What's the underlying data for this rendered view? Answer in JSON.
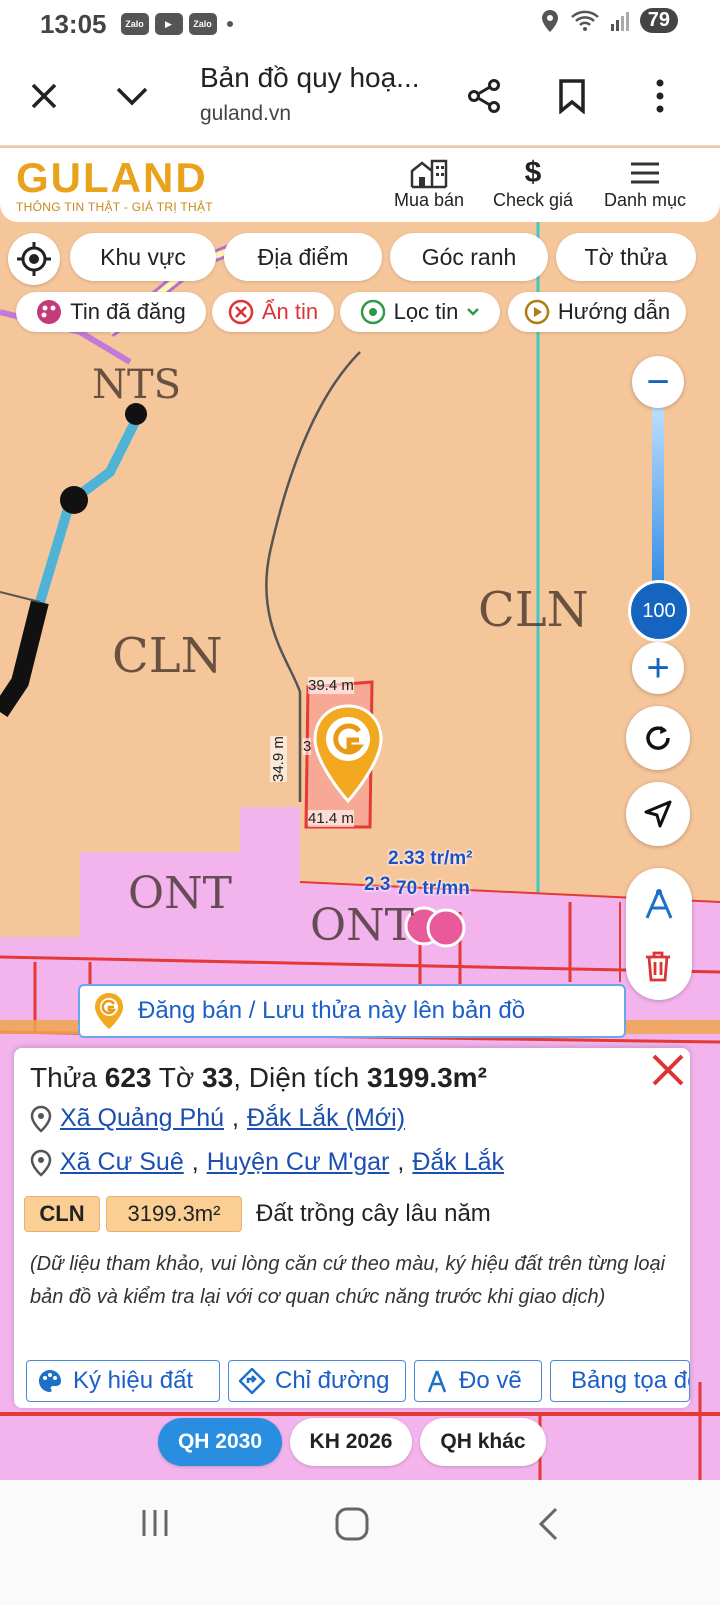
{
  "status": {
    "time": "13:05",
    "apps": [
      "Zalo",
      "Zalo",
      "Zalo"
    ],
    "battery": "79"
  },
  "browser": {
    "title": "Bản đồ quy hoạ...",
    "url": "guland.vn"
  },
  "site": {
    "logo": "GULAND",
    "tagline": "THÔNG TIN THẬT - GIÁ TRỊ THẬT",
    "nav": [
      "Mua bán",
      "Check giá",
      "Danh mục"
    ],
    "nav_icons": [
      "building-icon",
      "dollar-icon",
      "menu-icon"
    ]
  },
  "filters": {
    "row1": [
      "Khu vực",
      "Địa điểm",
      "Góc ranh",
      "Tờ thửa"
    ],
    "row2": [
      "Tin đã đăng",
      "Ẩn tin",
      "Lọc tin",
      "Hướng dẫn"
    ]
  },
  "map": {
    "labels": [
      "CLN",
      "CLN",
      "ONT",
      "ONT",
      "NTS"
    ],
    "zoom_minus": "−",
    "zoom_level": "100",
    "zoom_plus": "+",
    "parcel_dims": {
      "top": "39.4 m",
      "left": "34.9 m",
      "bottom": "41.4 m",
      "right": "3"
    },
    "prices": [
      "2.33 tr/m²",
      "2.3",
      "70 tr/mn"
    ],
    "colors": {
      "cln": "#f5c69a",
      "ont": "#f3b4ee",
      "boundary": "#e53935",
      "accent": "#1565c0",
      "brand": "#e8a21b"
    }
  },
  "post_banner": "Đăng bán / Lưu thửa này lên bản đồ",
  "card": {
    "title_prefix": "Thửa",
    "parcel": "623",
    "sheet_label": "Tờ",
    "sheet": "33",
    "area_label": ", Diện tích",
    "area": "3199.3m²",
    "addr1": {
      "commune": "Xã Quảng Phú",
      "province": "Đắk Lắk (Mới)"
    },
    "addr2": {
      "commune": "Xã Cư Suê",
      "district": "Huyện Cư M'gar",
      "province": "Đắk Lắk"
    },
    "land_code": "CLN",
    "land_area": "3199.3m²",
    "land_desc": "Đất trồng cây lâu năm",
    "note": "(Dữ liệu tham khảo, vui lòng căn cứ theo màu, ký hiệu đất trên từng loại bản đồ và kiểm tra lại với cơ quan chức năng trước khi giao dịch)",
    "actions": [
      "Ký hiệu đất",
      "Chỉ đường",
      "Đo vẽ",
      "Bảng tọa độ"
    ]
  },
  "plan_tabs": [
    "QH 2030",
    "KH 2026",
    "QH khác"
  ]
}
